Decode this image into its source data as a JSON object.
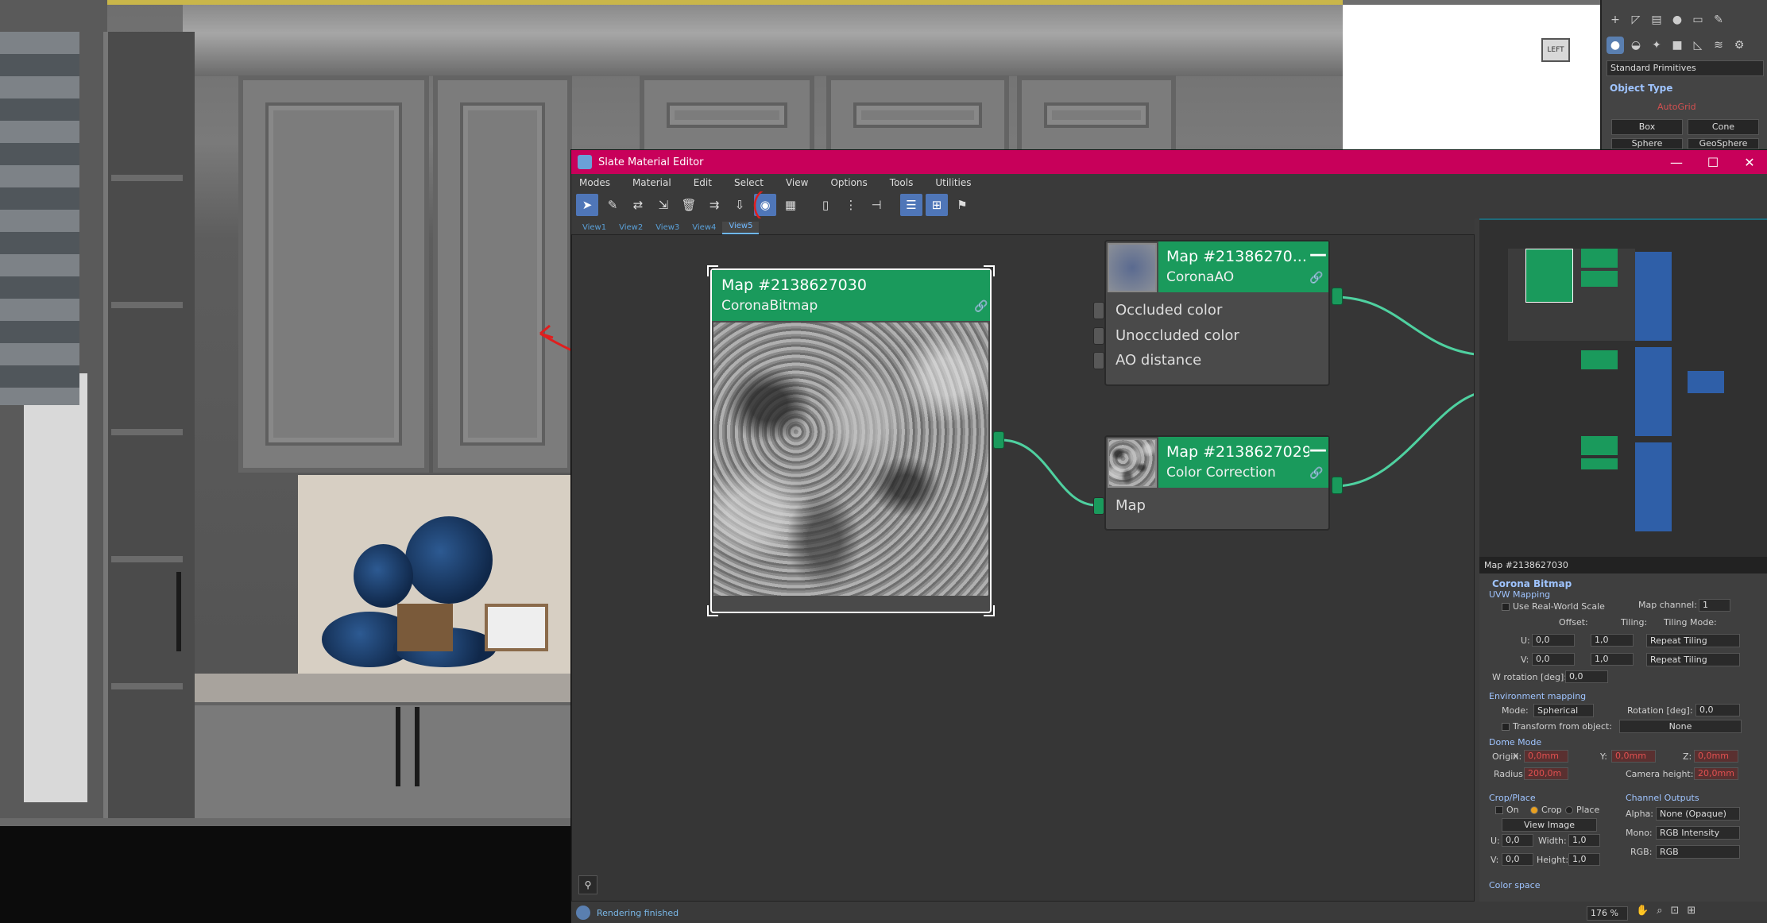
{
  "viewport": {
    "cube_label": "LEFT"
  },
  "command_panel": {
    "dropdown": "Standard Primitives",
    "rollout_title": "Object Type",
    "autogrid_label": "AutoGrid",
    "buttons": [
      "Box",
      "Cone",
      "Sphere",
      "GeoSphere"
    ]
  },
  "editor": {
    "title": "Slate Material Editor",
    "window_buttons": [
      "—",
      "☐",
      "✕"
    ],
    "menus": [
      "Modes",
      "Material",
      "Edit",
      "Select",
      "View",
      "Options",
      "Tools",
      "Utilities"
    ],
    "tabs": [
      "View1",
      "View2",
      "View3",
      "View4",
      "View5"
    ],
    "active_tab": "View5",
    "status_text": "Rendering finished",
    "zoom": "176 %"
  },
  "nodes": {
    "bitmap": {
      "title": "Map #2138627030",
      "subtitle": "CoronaBitmap"
    },
    "ao": {
      "title": "Map #21386270...",
      "subtitle": "CoronaAO",
      "sockets": [
        "Occluded color",
        "Unoccluded color",
        "AO distance"
      ]
    },
    "cc": {
      "title": "Map #2138627029",
      "subtitle": "Color Correction",
      "sockets": [
        "Map"
      ]
    }
  },
  "params": {
    "header": "Map #2138627030",
    "rollout": "Corona Bitmap",
    "uvw_section": "UVW Mapping",
    "use_real_world": "Use Real-World Scale",
    "map_channel_label": "Map channel:",
    "map_channel": "1",
    "offset_label": "Offset:",
    "tiling_label": "Tiling:",
    "tiling_mode_label": "Tiling Mode:",
    "u_label": "U:",
    "v_label": "V:",
    "u_offset": "0,0",
    "u_tiling": "1,0",
    "u_mode": "Repeat Tiling",
    "v_offset": "0,0",
    "v_tiling": "1,0",
    "v_mode": "Repeat Tiling",
    "w_rotation_label": "W rotation [deg]:",
    "w_rotation": "0,0",
    "env_section": "Environment mapping",
    "mode_label": "Mode:",
    "mode_value": "Spherical",
    "rotation_label": "Rotation [deg]:",
    "rotation_value": "0,0",
    "transform_label": "Transform from object:",
    "transform_value": "None",
    "dome_section": "Dome Mode",
    "origin_label": "Origin",
    "x_label": "X:",
    "y_label": "Y:",
    "z_label": "Z:",
    "origin_x": "0,0mm",
    "origin_y": "0,0mm",
    "origin_z": "0,0mm",
    "radius_label": "Radius:",
    "radius_value": "200,0m",
    "camera_height_label": "Camera height:",
    "camera_height": "20,0mm",
    "crop_section": "Crop/Place",
    "on_label": "On",
    "crop_label": "Crop",
    "place_label": "Place",
    "view_image": "View Image",
    "crop_u_label": "U:",
    "crop_u": "0,0",
    "width_label": "Width:",
    "width_value": "1,0",
    "crop_v_label": "V:",
    "crop_v": "0,0",
    "height_label": "Height:",
    "height_value": "1,0",
    "channel_outputs": "Channel Outputs",
    "alpha_label": "Alpha:",
    "alpha_value": "None (Opaque)",
    "mono_label": "Mono:",
    "mono_value": "RGB Intensity",
    "rgb_label": "RGB:",
    "rgb_value": "RGB",
    "color_space": "Color space"
  },
  "colors": {
    "title_bar": "#c8005a",
    "node_header": "#1a9a5c",
    "wire": "#4fd1a0",
    "annotation": "#e01e1e",
    "nav_blue": "#2f5fa8"
  }
}
